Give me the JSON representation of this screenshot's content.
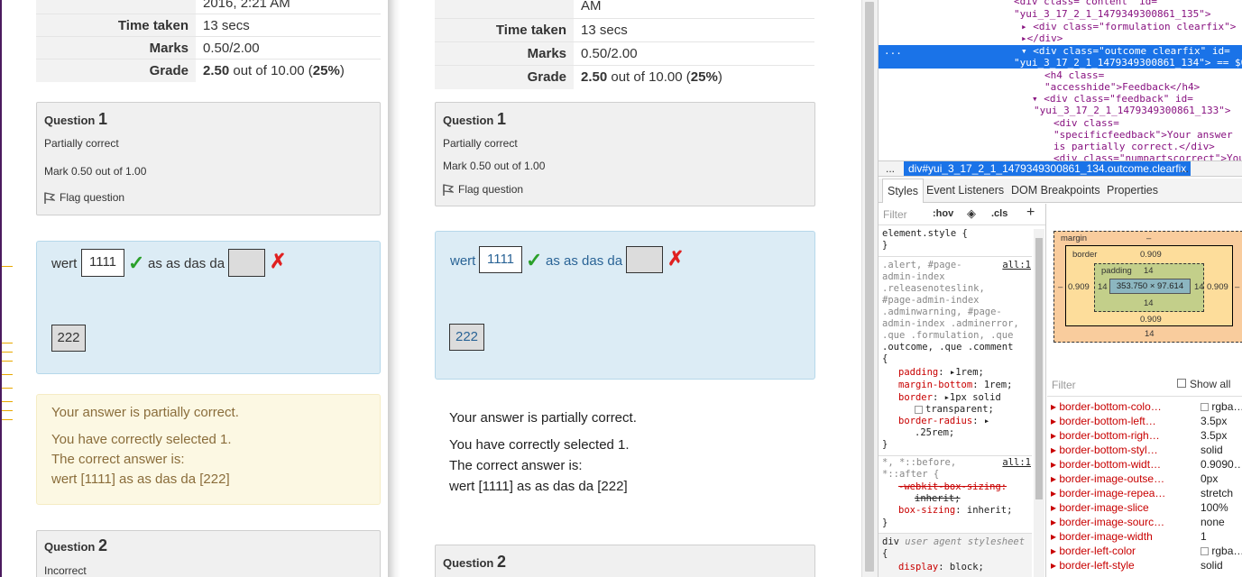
{
  "left_view": {
    "summary": [
      {
        "label": "",
        "value": "2016, 2:21 AM"
      },
      {
        "label": "Time taken",
        "value": "13 secs"
      },
      {
        "label": "Marks",
        "value": "0.50/2.00"
      },
      {
        "label": "Grade",
        "value_bold": "2.50",
        "value_rest": " out of 10.00 (",
        "value_pct": "25%",
        "value_end": ")"
      }
    ],
    "question1": {
      "label": "Question",
      "number": "1",
      "state": "Partially correct",
      "mark": "Mark 0.50 out of 1.00",
      "flag": "Flag question"
    },
    "formulation": {
      "text1": "wert",
      "answer1": "1111",
      "text2": "as as das da",
      "drag_item": "222"
    },
    "feedback": {
      "specific": "Your answer is partially correct.",
      "selected": "You have correctly selected 1.",
      "correct_intro": "The correct answer is:",
      "correct": "wert [1111] as as das da [222]"
    },
    "question2": {
      "label": "Question",
      "number": "2",
      "state": "Incorrect"
    }
  },
  "mid_view": {
    "summary": [
      {
        "label": "",
        "value": "AM"
      },
      {
        "label": "Time taken",
        "value": "13 secs"
      },
      {
        "label": "Marks",
        "value": "0.50/2.00"
      },
      {
        "label": "Grade",
        "value_bold": "2.50",
        "value_rest": " out of 10.00 (",
        "value_pct": "25%",
        "value_end": ")"
      }
    ],
    "question1": {
      "label": "Question",
      "number": "1",
      "state": "Partially correct",
      "mark": "Mark 0.50 out of 1.00",
      "flag": "Flag question"
    },
    "formulation": {
      "text1": "wert",
      "answer1": "1111",
      "text2": "as as das da",
      "drag_item": "222"
    },
    "feedback": {
      "specific": "Your answer is partially correct.",
      "selected": "You have correctly selected 1.",
      "correct_intro": "The correct answer is:",
      "correct": "wert [1111] as as das da [222]"
    },
    "question2": {
      "label": "Question",
      "number": "2"
    }
  },
  "devtools": {
    "dom": {
      "l1": "<div class=\"content\" id=",
      "l2": "\"yui_3_17_2_1_1479349300861_135\">",
      "l3": "<div class=\"formulation clearfix\">",
      "l4": "</div>",
      "sel1": "<div class=\"outcome clearfix\" id=",
      "sel2": "\"yui_3_17_2_1_1479349300861_134\"> == $0",
      "l5": "<h4 class=",
      "l6": "\"accesshide\">Feedback</h4>",
      "l7": "<div class=\"feedback\" id=",
      "l8": "\"yui_3_17_2_1_1479349300861_133\">",
      "l9": "<div class=",
      "l10": "\"specificfeedback\">Your answer",
      "l11": "is partially correct.</div>",
      "l12": "<div class=\"numpartscorrect\">Your",
      "ellipsis": "..."
    },
    "breadcrumb": {
      "left": "...",
      "selected": "div#yui_3_17_2_1_1479349300861_134.outcome.clearfix",
      "right": "..."
    },
    "tabs": [
      "Styles",
      "Event Listeners",
      "DOM Breakpoints",
      "Properties"
    ],
    "styles_filter": {
      "placeholder": "Filter",
      "hov": ":hov",
      "cls": ".cls",
      "add": "+"
    },
    "rules": {
      "r1_sel": "element.style {",
      "r1_end": "}",
      "r2_link": "all:1",
      "r2_sel": [
        ".alert, #page-",
        "admin-index",
        ".releasenoteslink,",
        "#page-admin-index",
        ".adminwarning, #page-",
        "admin-index .adminerror,",
        ".que .formulation, .que",
        ".outcome, .que .comment",
        "{"
      ],
      "r2_props": [
        {
          "p": "padding",
          "v": "1rem;"
        },
        {
          "p": "margin-bottom",
          "v": "1rem;"
        },
        {
          "p": "border",
          "v": "1px solid"
        },
        {
          "p": "",
          "v": "transparent;"
        },
        {
          "p": "border-radius",
          "v": ""
        },
        {
          "p": "",
          "v": ".25rem;"
        }
      ],
      "r2_end": "}",
      "r3_link": "all:1",
      "r3_sel": [
        "*, *::before,",
        "*::after {"
      ],
      "r3_struck1": "-webkit-box-sizing:",
      "r3_struck2": "inherit;",
      "r3_prop": "box-sizing",
      "r3_val": "inherit;",
      "r3_end": "}",
      "r4_sel": "div",
      "r4_src": "user agent stylesheet",
      "r4_open": "{",
      "r4_prop": "display",
      "r4_val": "block;"
    },
    "boxmodel": {
      "margin_label": "margin",
      "margin_dash": "–",
      "border_label": "border",
      "border_top": "0.909",
      "border_left": "0.909",
      "border_right": "0.909",
      "border_bottom": "0.909",
      "padding_label": "padding",
      "padding_top": "14",
      "padding_left": "14",
      "padding_right": "14",
      "padding_bottom": "14",
      "content": "353.750 × 97.614",
      "margin_left": "–",
      "margin_right": "–",
      "margin_bottom": "14"
    },
    "computed_filter": {
      "placeholder": "Filter",
      "show_all": "Show all"
    },
    "computed": [
      {
        "p": "border-bottom-colo…",
        "v": "rgba…"
      },
      {
        "p": "border-bottom-left…",
        "v": "3.5px"
      },
      {
        "p": "border-bottom-righ…",
        "v": "3.5px"
      },
      {
        "p": "border-bottom-styl…",
        "v": "solid"
      },
      {
        "p": "border-bottom-widt…",
        "v": "0.9090…"
      },
      {
        "p": "border-image-outse…",
        "v": "0px"
      },
      {
        "p": "border-image-repea…",
        "v": "stretch"
      },
      {
        "p": "border-image-slice",
        "v": "100%"
      },
      {
        "p": "border-image-sourc…",
        "v": "none"
      },
      {
        "p": "border-image-width",
        "v": "1"
      },
      {
        "p": "border-left-color",
        "v": "rgba…"
      },
      {
        "p": "border-left-style",
        "v": "solid"
      }
    ]
  }
}
